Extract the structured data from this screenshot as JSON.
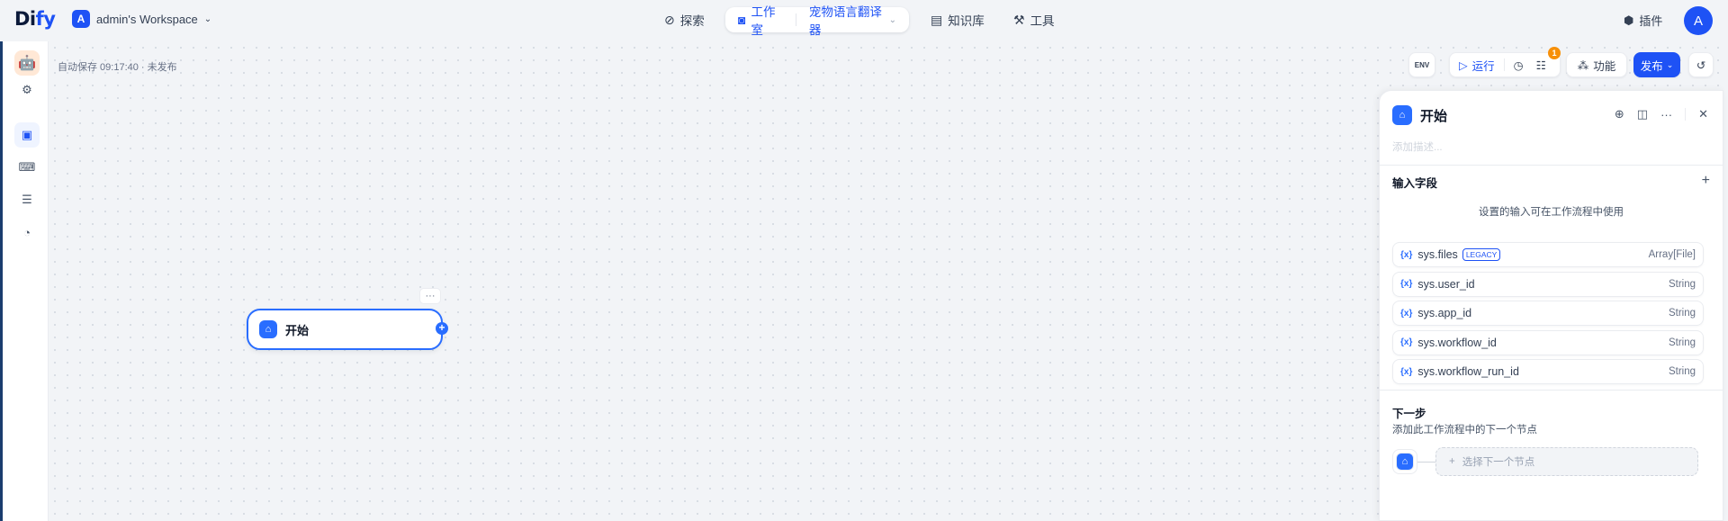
{
  "header": {
    "logo_main": "Di",
    "logo_accent": "fy",
    "workspace_avatar": "A",
    "workspace_name": "admin's Workspace",
    "nav": {
      "explore": "探索",
      "studio": "工作室",
      "app_name": "宠物语言翻译器",
      "knowledge": "知识库",
      "tools": "工具"
    },
    "plugins": "插件",
    "user_avatar": "A"
  },
  "canvas": {
    "autosave": "自动保存 09:17:40 · 未发布"
  },
  "toolbar": {
    "env": "ENV",
    "run": "运行",
    "checklist_badge": "1",
    "features": "功能",
    "publish": "发布"
  },
  "node": {
    "title": "开始",
    "more": "···",
    "handle": "+"
  },
  "panel": {
    "title": "开始",
    "description_placeholder": "添加描述...",
    "input_fields_title": "输入字段",
    "add_symbol": "+",
    "hint": "设置的输入可在工作流程中使用",
    "variables": [
      {
        "name": "sys.files",
        "badge": "LEGACY",
        "type": "Array[File]"
      },
      {
        "name": "sys.user_id",
        "badge": "",
        "type": "String"
      },
      {
        "name": "sys.app_id",
        "badge": "",
        "type": "String"
      },
      {
        "name": "sys.workflow_id",
        "badge": "",
        "type": "String"
      },
      {
        "name": "sys.workflow_run_id",
        "badge": "",
        "type": "String"
      }
    ],
    "var_symbol": "{x}",
    "next_title": "下一步",
    "next_subtitle": "添加此工作流程中的下一个节点",
    "next_choose": "选择下一个节点",
    "next_plus": "+"
  },
  "colors": {
    "accent": "#1e52f5",
    "node_blue": "#296dff",
    "badge_orange": "#f79009"
  },
  "icons": [
    "explore-icon",
    "studio-icon",
    "knowledge-icon",
    "tools-icon",
    "plugin-icon",
    "run-icon",
    "history-icon",
    "checklist-icon",
    "features-icon",
    "home-icon"
  ]
}
